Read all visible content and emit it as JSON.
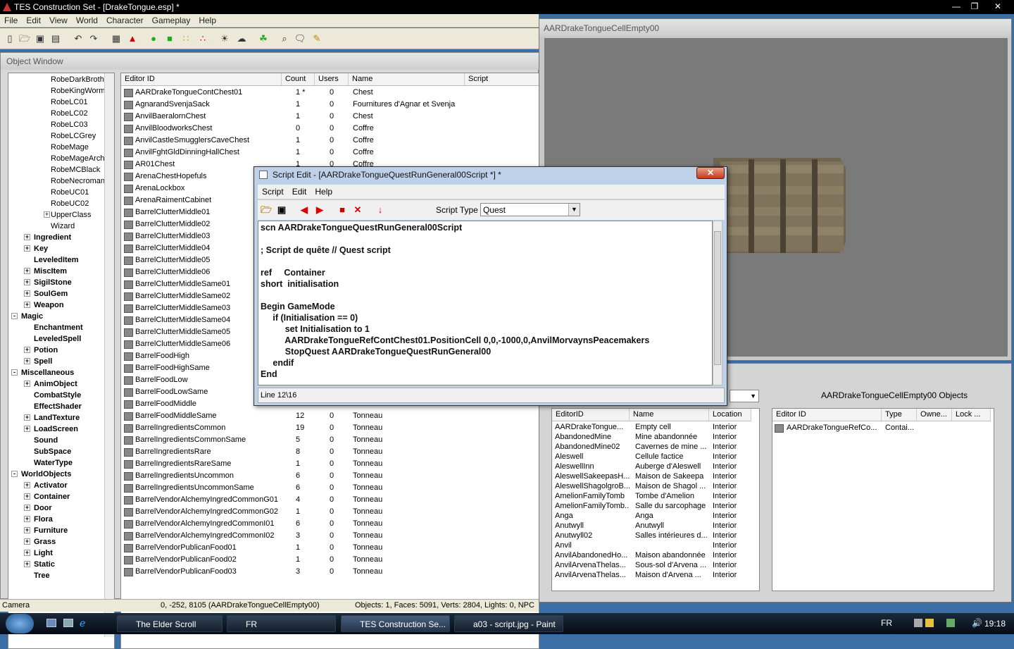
{
  "window": {
    "title": "TES Construction Set - [DrakeTongue.esp] *"
  },
  "menu": [
    "File",
    "Edit",
    "View",
    "World",
    "Character",
    "Gameplay",
    "Help"
  ],
  "object_window": {
    "title": "Object Window",
    "tree": [
      {
        "label": "RobeDarkBrothe",
        "level": 3,
        "bold": false,
        "expander": ""
      },
      {
        "label": "RobeKingWorm",
        "level": 3,
        "bold": false,
        "expander": ""
      },
      {
        "label": "RobeLC01",
        "level": 3,
        "bold": false,
        "expander": ""
      },
      {
        "label": "RobeLC02",
        "level": 3,
        "bold": false,
        "expander": ""
      },
      {
        "label": "RobeLC03",
        "level": 3,
        "bold": false,
        "expander": ""
      },
      {
        "label": "RobeLCGrey",
        "level": 3,
        "bold": false,
        "expander": ""
      },
      {
        "label": "RobeMage",
        "level": 3,
        "bold": false,
        "expander": ""
      },
      {
        "label": "RobeMageArch",
        "level": 3,
        "bold": false,
        "expander": ""
      },
      {
        "label": "RobeMCBlack",
        "level": 3,
        "bold": false,
        "expander": ""
      },
      {
        "label": "RobeNecroman",
        "level": 3,
        "bold": false,
        "expander": ""
      },
      {
        "label": "RobeUC01",
        "level": 3,
        "bold": false,
        "expander": ""
      },
      {
        "label": "RobeUC02",
        "level": 3,
        "bold": false,
        "expander": ""
      },
      {
        "label": "UpperClass",
        "level": 3,
        "bold": false,
        "expander": "+"
      },
      {
        "label": "Wizard",
        "level": 3,
        "bold": false,
        "expander": ""
      },
      {
        "label": "Ingredient",
        "level": 1,
        "bold": true,
        "expander": "+"
      },
      {
        "label": "Key",
        "level": 1,
        "bold": true,
        "expander": "+"
      },
      {
        "label": "LeveledItem",
        "level": 1,
        "bold": true,
        "expander": ""
      },
      {
        "label": "MiscItem",
        "level": 1,
        "bold": true,
        "expander": "+"
      },
      {
        "label": "SigilStone",
        "level": 1,
        "bold": true,
        "expander": "+"
      },
      {
        "label": "SoulGem",
        "level": 1,
        "bold": true,
        "expander": "+"
      },
      {
        "label": "Weapon",
        "level": 1,
        "bold": true,
        "expander": "+"
      },
      {
        "label": "Magic",
        "level": 0,
        "bold": true,
        "expander": "-"
      },
      {
        "label": "Enchantment",
        "level": 1,
        "bold": true,
        "expander": ""
      },
      {
        "label": "LeveledSpell",
        "level": 1,
        "bold": true,
        "expander": ""
      },
      {
        "label": "Potion",
        "level": 1,
        "bold": true,
        "expander": "+"
      },
      {
        "label": "Spell",
        "level": 1,
        "bold": true,
        "expander": "+"
      },
      {
        "label": "Miscellaneous",
        "level": 0,
        "bold": true,
        "expander": "-"
      },
      {
        "label": "AnimObject",
        "level": 1,
        "bold": true,
        "expander": "+"
      },
      {
        "label": "CombatStyle",
        "level": 1,
        "bold": true,
        "expander": ""
      },
      {
        "label": "EffectShader",
        "level": 1,
        "bold": true,
        "expander": ""
      },
      {
        "label": "LandTexture",
        "level": 1,
        "bold": true,
        "expander": "+"
      },
      {
        "label": "LoadScreen",
        "level": 1,
        "bold": true,
        "expander": "+"
      },
      {
        "label": "Sound",
        "level": 1,
        "bold": true,
        "expander": ""
      },
      {
        "label": "SubSpace",
        "level": 1,
        "bold": true,
        "expander": ""
      },
      {
        "label": "WaterType",
        "level": 1,
        "bold": true,
        "expander": ""
      },
      {
        "label": "WorldObjects",
        "level": 0,
        "bold": true,
        "expander": "-"
      },
      {
        "label": "Activator",
        "level": 1,
        "bold": true,
        "expander": "+"
      },
      {
        "label": "Container",
        "level": 1,
        "bold": true,
        "expander": "+"
      },
      {
        "label": "Door",
        "level": 1,
        "bold": true,
        "expander": "+"
      },
      {
        "label": "Flora",
        "level": 1,
        "bold": true,
        "expander": "+"
      },
      {
        "label": "Furniture",
        "level": 1,
        "bold": true,
        "expander": "+"
      },
      {
        "label": "Grass",
        "level": 1,
        "bold": true,
        "expander": "+"
      },
      {
        "label": "Light",
        "level": 1,
        "bold": true,
        "expander": "+"
      },
      {
        "label": "Static",
        "level": 1,
        "bold": true,
        "expander": "+"
      },
      {
        "label": "Tree",
        "level": 1,
        "bold": true,
        "expander": ""
      }
    ],
    "columns": [
      "Editor ID",
      "Count",
      "Users",
      "Name",
      "Script"
    ],
    "rows": [
      [
        "AARDrakeTongueContChest01",
        "1 *",
        "0",
        "Chest"
      ],
      [
        "AgnarandSvenjaSack",
        "1",
        "0",
        "Fournitures d'Agnar et Svenja"
      ],
      [
        "AnvilBaeralornChest",
        "1",
        "0",
        "Chest"
      ],
      [
        "AnvilBloodworksChest",
        "0",
        "0",
        "Coffre"
      ],
      [
        "AnvilCastleSmugglersCaveChest",
        "1",
        "0",
        "Coffre"
      ],
      [
        "AnvilFghtGldDinningHallChest",
        "1",
        "0",
        "Coffre"
      ],
      [
        "AR01Chest",
        "1",
        "0",
        "Coffre"
      ],
      [
        "ArenaChestHopefuls",
        "",
        "",
        ""
      ],
      [
        "ArenaLockbox",
        "",
        "",
        ""
      ],
      [
        "ArenaRaimentCabinet",
        "",
        "",
        ""
      ],
      [
        "BarrelClutterMiddle01",
        "",
        "",
        ""
      ],
      [
        "BarrelClutterMiddle02",
        "",
        "",
        ""
      ],
      [
        "BarrelClutterMiddle03",
        "",
        "",
        ""
      ],
      [
        "BarrelClutterMiddle04",
        "",
        "",
        ""
      ],
      [
        "BarrelClutterMiddle05",
        "",
        "",
        ""
      ],
      [
        "BarrelClutterMiddle06",
        "",
        "",
        ""
      ],
      [
        "BarrelClutterMiddleSame01",
        "",
        "",
        ""
      ],
      [
        "BarrelClutterMiddleSame02",
        "",
        "",
        ""
      ],
      [
        "BarrelClutterMiddleSame03",
        "",
        "",
        ""
      ],
      [
        "BarrelClutterMiddleSame04",
        "",
        "",
        ""
      ],
      [
        "BarrelClutterMiddleSame05",
        "",
        "",
        ""
      ],
      [
        "BarrelClutterMiddleSame06",
        "",
        "",
        ""
      ],
      [
        "BarrelFoodHigh",
        "",
        "",
        ""
      ],
      [
        "BarrelFoodHighSame",
        "",
        "",
        ""
      ],
      [
        "BarrelFoodLow",
        "",
        "",
        ""
      ],
      [
        "BarrelFoodLowSame",
        "",
        "",
        ""
      ],
      [
        "BarrelFoodMiddle",
        "",
        "",
        ""
      ],
      [
        "BarrelFoodMiddleSame",
        "12",
        "0",
        "Tonneau"
      ],
      [
        "BarrelIngredientsCommon",
        "19",
        "0",
        "Tonneau"
      ],
      [
        "BarrelIngredientsCommonSame",
        "5",
        "0",
        "Tonneau"
      ],
      [
        "BarrelIngredientsRare",
        "8",
        "0",
        "Tonneau"
      ],
      [
        "BarrelIngredientsRareSame",
        "1",
        "0",
        "Tonneau"
      ],
      [
        "BarrelIngredientsUncommon",
        "6",
        "0",
        "Tonneau"
      ],
      [
        "BarrelIngredientsUncommonSame",
        "6",
        "0",
        "Tonneau"
      ],
      [
        "BarrelVendorAlchemyIngredCommonG01",
        "4",
        "0",
        "Tonneau"
      ],
      [
        "BarrelVendorAlchemyIngredCommonG02",
        "1",
        "0",
        "Tonneau"
      ],
      [
        "BarrelVendorAlchemyIngredCommonI01",
        "6",
        "0",
        "Tonneau"
      ],
      [
        "BarrelVendorAlchemyIngredCommonI02",
        "3",
        "0",
        "Tonneau"
      ],
      [
        "BarrelVendorPublicanFood01",
        "1",
        "0",
        "Tonneau"
      ],
      [
        "BarrelVendorPublicanFood02",
        "1",
        "0",
        "Tonneau"
      ],
      [
        "BarrelVendorPublicanFood03",
        "3",
        "0",
        "Tonneau"
      ]
    ]
  },
  "status_bar": {
    "mode": "Camera",
    "coords": "0, -252, 8105 (AARDrakeTongueCellEmpty00)",
    "stats": "Objects: 1, Faces: 5091, Verts: 2804, Lights: 0, NPC"
  },
  "render_window": {
    "title": "AARDrakeTongueCellEmpty00"
  },
  "cell_view": {
    "objects_title": "AARDrakeTongueCellEmpty00 Objects",
    "cell_columns": [
      "EditorID",
      "Name",
      "Location"
    ],
    "cells": [
      [
        "AARDrakeTongue...",
        "Empty cell",
        "Interior"
      ],
      [
        "AbandonedMine",
        "Mine abandonnée",
        "Interior"
      ],
      [
        "AbandonedMine02",
        "Cavernes de mine ...",
        "Interior"
      ],
      [
        "Aleswell",
        "Cellule factice",
        "Interior"
      ],
      [
        "AleswellInn",
        "Auberge d'Aleswell",
        "Interior"
      ],
      [
        "AleswellSakeepasH...",
        "Maison de Sakeepa",
        "Interior"
      ],
      [
        "AleswellShagolgroB...",
        "Maison de Shagol ...",
        "Interior"
      ],
      [
        "AmelionFamilyTomb",
        "Tombe d'Amelion",
        "Interior"
      ],
      [
        "AmelionFamilyTomb...",
        "Salle du sarcophage",
        "Interior"
      ],
      [
        "Anga",
        "Anga",
        "Interior"
      ],
      [
        "Anutwyll",
        "Anutwyll",
        "Interior"
      ],
      [
        "Anutwyll02",
        "Salles intérieures d...",
        "Interior"
      ],
      [
        "Anvil",
        "",
        "Interior"
      ],
      [
        "AnvilAbandonedHo...",
        "Maison abandonnée",
        "Interior"
      ],
      [
        "AnvilArvenaThelas...",
        "Sous-sol d'Arvena ...",
        "Interior"
      ],
      [
        "AnvilArvenaThelas...",
        "Maison d'Arvena ...",
        "Interior"
      ]
    ],
    "object_columns": [
      "Editor ID",
      "Type",
      "Owne...",
      "Lock ..."
    ],
    "objects": [
      [
        "AARDrakeTongueRefCo...",
        "Contai...",
        "",
        ""
      ]
    ]
  },
  "script_editor": {
    "title": "Script Edit - [AARDrakeTongueQuestRunGeneral00Script *] *",
    "menu": [
      "Script",
      "Edit",
      "Help"
    ],
    "script_type_label": "Script Type",
    "script_type_value": "Quest",
    "lines": [
      "scn AARDrakeTongueQuestRunGeneral00Script",
      "",
      "; Script de quête // Quest script",
      "",
      "ref     Container",
      "short  initialisation",
      "",
      "Begin GameMode",
      "     if (Initialisation == 0)",
      "          set Initialisation to 1",
      "          AARDrakeTongueRefContChest01.PositionCell 0,0,-1000,0,AnvilMorvaynsPeacemakers",
      "          StopQuest AARDrakeTongueQuestRunGeneral00",
      "     endif",
      "End"
    ],
    "status": "Line 12\\16"
  },
  "taskbar": {
    "tasks": [
      "The Elder Scroll",
      "FR",
      "TES Construction Se...",
      "a03 - script.jpg - Paint"
    ],
    "lang": "FR",
    "time": "19:18"
  }
}
